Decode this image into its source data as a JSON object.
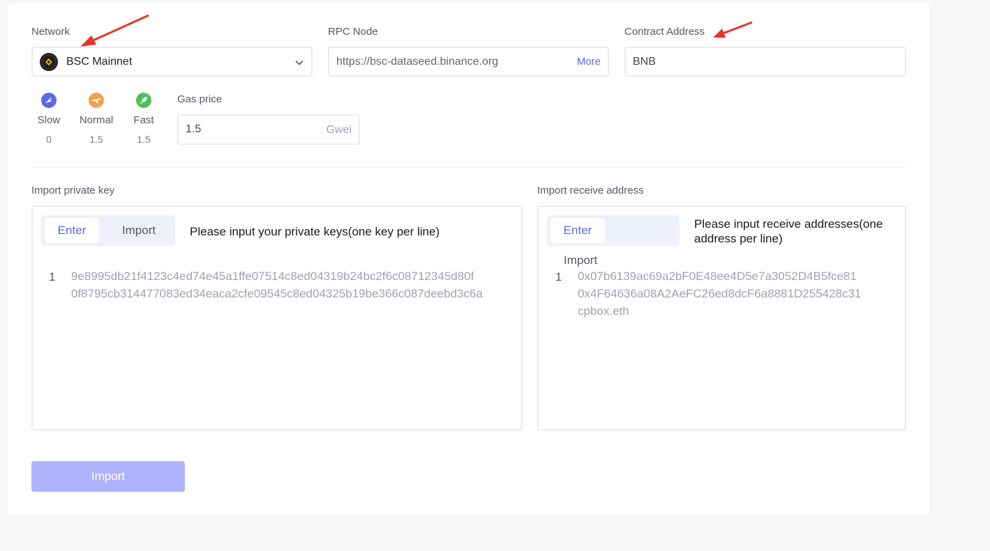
{
  "network": {
    "label": "Network",
    "selected": "BSC Mainnet",
    "icon": "bnb-chain-icon"
  },
  "rpc": {
    "label": "RPC Node",
    "value": "https://bsc-dataseed.binance.org",
    "more_label": "More"
  },
  "contract": {
    "label": "Contract Address",
    "value": "BNB"
  },
  "gas_speeds": [
    {
      "name": "Slow",
      "value": "0",
      "icon": "bird-icon",
      "color": "#5b6ae6"
    },
    {
      "name": "Normal",
      "value": "1.5",
      "icon": "plane-icon",
      "color": "#f5a04a"
    },
    {
      "name": "Fast",
      "value": "1.5",
      "icon": "rocket-icon",
      "color": "#4cc35a"
    }
  ],
  "gas_price": {
    "label": "Gas price",
    "value": "1.5",
    "unit": "Gwei"
  },
  "private_key": {
    "label": "Import private key",
    "tab_enter": "Enter",
    "tab_import": "Import",
    "hint": "Please input your private keys(one key per line)",
    "line_number": "1",
    "lines": [
      "9e8995db21f4123c4ed74e45a1ffe07514c8ed04319b24bc2f6c08712345d80f",
      "0f8795cb314477083ed34eaca2cfe09545c8ed04325b19be366c087deebd3c6a"
    ]
  },
  "receive": {
    "label": "Import receive address",
    "tab_enter": "Enter",
    "tab_import": "Import",
    "hint": "Please input receive addresses(one address per line)",
    "line_number": "1",
    "lines": [
      "0x07b6139ac69a2bF0E48ee4D5e7a3052D4B5fce81",
      "0x4F64636a08A2AeFC26ed8dcF6a8881D255428c31",
      "cpbox.eth"
    ]
  },
  "import_button": "Import",
  "colors": {
    "accent": "#5b6ae6",
    "button_disabled": "#aeb4fb",
    "annotation_arrow": "#e8332a"
  }
}
